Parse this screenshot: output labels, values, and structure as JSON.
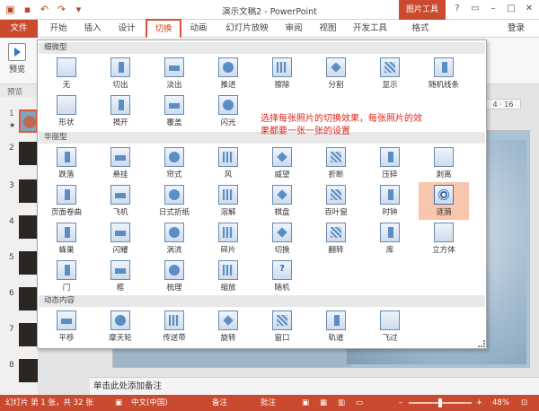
{
  "window": {
    "title": "演示文稿2 - PowerPoint",
    "context_tab": "图片工具"
  },
  "tabs": [
    "文件",
    "开始",
    "插入",
    "设计",
    "切换",
    "动画",
    "幻灯片放映",
    "审阅",
    "视图",
    "开发工具",
    "格式"
  ],
  "login": "登录",
  "ribbon": {
    "preview_label": "预览",
    "preview_group": "预览"
  },
  "ruler_text": "4 · 16",
  "gallery": {
    "sections": [
      {
        "title": "细微型",
        "items": [
          "无",
          "切出",
          "淡出",
          "推进",
          "擦除",
          "分割",
          "显示",
          "随机线条",
          "形状",
          "揭开",
          "覆盖",
          "闪光"
        ]
      },
      {
        "title": "华丽型",
        "items": [
          "跌落",
          "悬挂",
          "帘式",
          "风",
          "威望",
          "折断",
          "压碎",
          "剥离",
          "页面卷曲",
          "飞机",
          "日式折纸",
          "溶解",
          "棋盘",
          "百叶窗",
          "时钟",
          "涟漪",
          "蜂巢",
          "闪耀",
          "涡流",
          "碎片",
          "切换",
          "翻转",
          "库",
          "立方体",
          "门",
          "框",
          "梳理",
          "缩放",
          "随机"
        ]
      },
      {
        "title": "动态内容",
        "items": [
          "平移",
          "摩天轮",
          "传送带",
          "旋转",
          "窗口",
          "轨道",
          "飞过"
        ]
      }
    ],
    "selected": "涟漪",
    "random_icon": "?"
  },
  "annotation": "选择每张照片的切换效果，每张照片的效果都要一张一张的设置",
  "slides": [
    "1",
    "2",
    "3",
    "4",
    "5",
    "6",
    "7",
    "8"
  ],
  "slide_star": "★",
  "notes_placeholder": "单击此处添加备注",
  "status": {
    "slide_info": "幻灯片 第 1 张，共 32 张",
    "language": "中文(中国)",
    "notes": "备注",
    "comments": "批注",
    "zoom": "48%"
  },
  "colors": {
    "accent": "#c94a2e",
    "selected_item": "#f8c5ad",
    "annotation": "#e0241a"
  }
}
